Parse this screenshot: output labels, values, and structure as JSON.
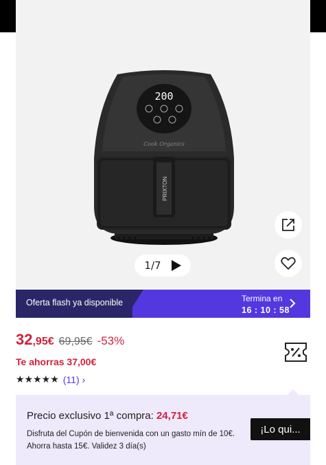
{
  "gallery": {
    "pager_text": "1/7",
    "product_display": "200",
    "product_brand": "PRIXTON",
    "product_script_logo": "Cook Organics"
  },
  "flash": {
    "label": "Oferta flash ya disponible",
    "ends_label": "Termina en",
    "timer": "16 : 10 : 58"
  },
  "price": {
    "current_int": "32",
    "current_dec": ",95€",
    "original": "69,95€",
    "discount": "-53%",
    "savings": "Te ahorras 37,00€"
  },
  "rating": {
    "stars": "★★★★★",
    "count": "(11) ›",
    "value": 5
  },
  "promo": {
    "title_prefix": "Precio exclusivo 1ª compra: ",
    "title_amount": "24,71€",
    "description": "Disfruta del Cupón de bienvenida con un gasto mín de 10€. Ahorra hasta 15€. Validez 3 día(s)",
    "button_label": "¡Lo qui..."
  },
  "colors": {
    "accent": "#5338e0",
    "price_red": "#d0213d",
    "flash_dark": "#2a2668",
    "promo_bg": "#eee9fb"
  },
  "icons": [
    "share-icon",
    "heart-icon",
    "play-icon",
    "chevron-right-icon",
    "coupon-icon",
    "star-icon"
  ]
}
